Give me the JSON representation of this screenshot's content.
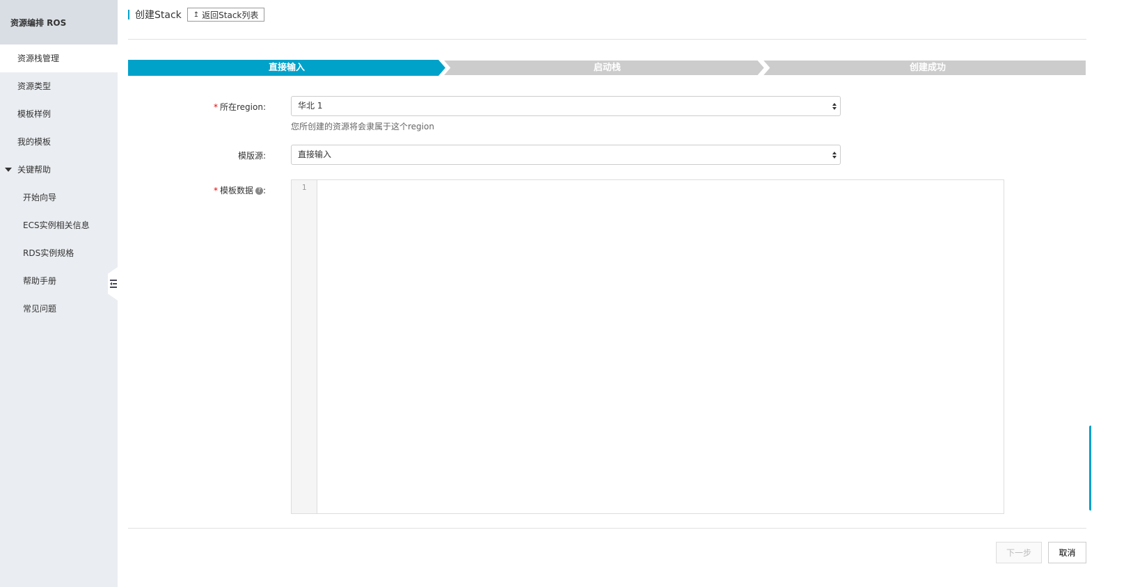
{
  "sidebar": {
    "title": "资源编排 ROS",
    "items": [
      {
        "label": "资源栈管理"
      },
      {
        "label": "资源类型"
      },
      {
        "label": "模板样例"
      },
      {
        "label": "我的模板"
      }
    ],
    "group": {
      "label": "关键帮助",
      "items": [
        {
          "label": "开始向导"
        },
        {
          "label": "ECS实例相关信息"
        },
        {
          "label": "RDS实例规格"
        },
        {
          "label": "帮助手册"
        },
        {
          "label": "常见问题"
        }
      ]
    }
  },
  "header": {
    "title": "创建Stack",
    "back_label": "返回Stack列表"
  },
  "steps": [
    {
      "label": "直接输入",
      "active": true
    },
    {
      "label": "启动栈",
      "active": false
    },
    {
      "label": "创建成功",
      "active": false
    }
  ],
  "form": {
    "region": {
      "label": "所在region:",
      "value": "华北 1",
      "help": "您所创建的资源将会隶属于这个region"
    },
    "template_source": {
      "label": "模版源:",
      "value": "直接输入"
    },
    "template_data": {
      "label": "模板数据",
      "suffix": ":",
      "help_glyph": "?",
      "line_number": "1"
    }
  },
  "footer": {
    "next_label": "下一步",
    "cancel_label": "取消"
  },
  "colors": {
    "accent": "#00a2ca",
    "step_inactive": "#cccccc",
    "sidebar_bg": "#eaedf1"
  }
}
